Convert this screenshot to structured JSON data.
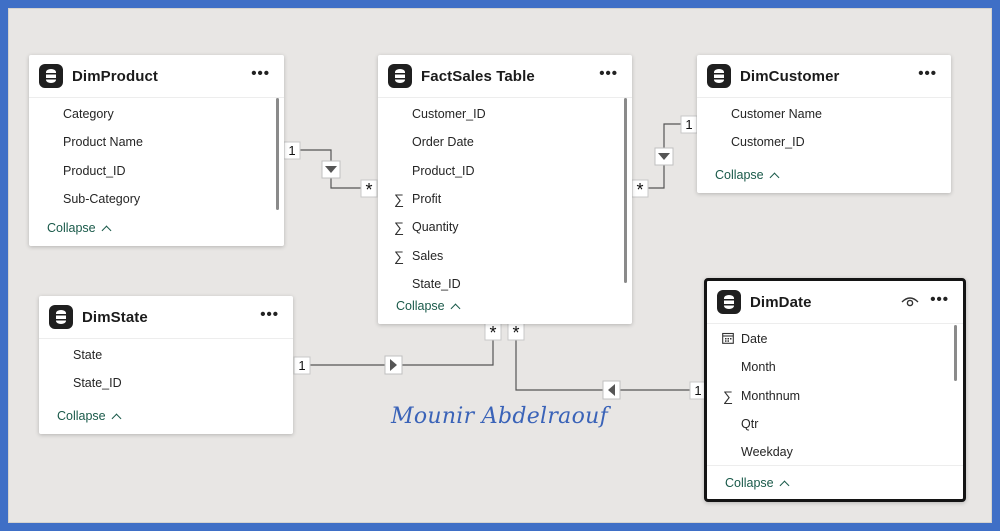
{
  "tables": {
    "dimproduct": {
      "title": "DimProduct",
      "fields": [
        "Category",
        "Product Name",
        "Product_ID",
        "Sub-Category"
      ],
      "collapse": "Collapse"
    },
    "factsales": {
      "title": "FactSales Table",
      "fields": [
        "Customer_ID",
        "Order Date",
        "Product_ID",
        "Profit",
        "Quantity",
        "Sales",
        "State_ID"
      ],
      "sigma_fields": [
        "Profit",
        "Quantity",
        "Sales"
      ],
      "collapse": "Collapse"
    },
    "dimcustomer": {
      "title": "DimCustomer",
      "fields": [
        "Customer Name",
        "Customer_ID"
      ],
      "collapse": "Collapse"
    },
    "dimstate": {
      "title": "DimState",
      "fields": [
        "State",
        "State_ID"
      ],
      "collapse": "Collapse"
    },
    "dimdate": {
      "title": "DimDate",
      "fields": [
        "Date",
        "Month",
        "Monthnum",
        "Qtr",
        "Weekday"
      ],
      "collapse": "Collapse",
      "selected": true
    }
  },
  "relationships": {
    "product_fact": {
      "one": "1",
      "many": "*"
    },
    "customer_fact": {
      "one": "1",
      "many": "*"
    },
    "state_fact": {
      "one": "1",
      "many": "*"
    },
    "date_fact": {
      "one": "1",
      "many": "*"
    }
  },
  "icons": {
    "table": "table-icon",
    "more": "more-options-icon",
    "sigma": "sigma-icon",
    "calendar": "calendar-icon",
    "eye": "eye-icon",
    "filter_direction": "triangle-arrow-icon"
  },
  "watermark": "Mounir Abdelraouf",
  "colors": {
    "frame": "#3f6fc6",
    "canvas": "#e8e6e4",
    "collapse_link": "#1a5a4a",
    "watermark": "#3a63b8"
  }
}
